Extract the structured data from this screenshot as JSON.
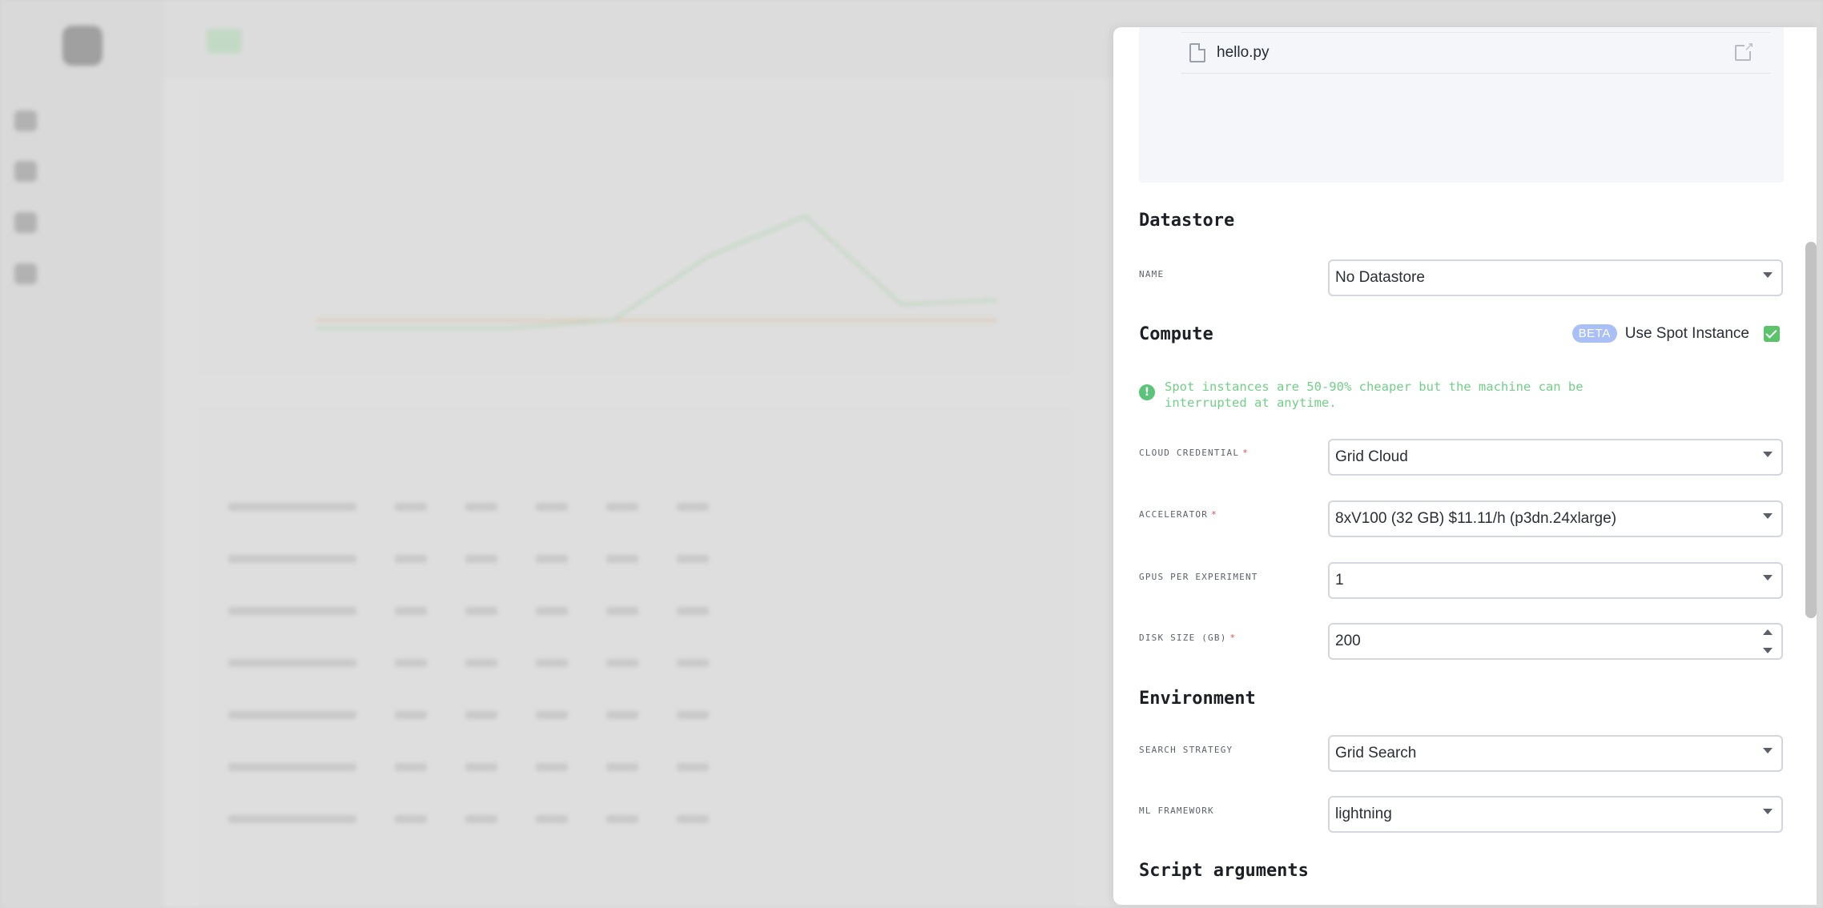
{
  "code_panel": {
    "file_name": "hello.py"
  },
  "datastore": {
    "title": "Datastore",
    "name_label": "NAME",
    "name_value": "No Datastore"
  },
  "compute": {
    "title": "Compute",
    "beta_badge": "BETA",
    "spot_label": "Use Spot Instance",
    "spot_checked": true,
    "spot_notice": "Spot instances are 50-90% cheaper but the machine can be interrupted at anytime.",
    "cloud_credential_label": "CLOUD CREDENTIAL",
    "cloud_credential_value": "Grid Cloud",
    "accelerator_label": "ACCELERATOR",
    "accelerator_value": "8xV100 (32 GB) $11.11/h (p3dn.24xlarge)",
    "gpus_label": "GPUS PER EXPERIMENT",
    "gpus_value": "1",
    "disk_label": "DISK SIZE (GB)",
    "disk_value": "200",
    "required_marker": "*"
  },
  "environment": {
    "title": "Environment",
    "search_strategy_label": "SEARCH STRATEGY",
    "search_strategy_value": "Grid Search",
    "ml_framework_label": "ML FRAMEWORK",
    "ml_framework_value": "lightning"
  },
  "script_arguments": {
    "title": "Script arguments"
  },
  "colors": {
    "accent_green": "#5bc46b",
    "beta_badge": "#a9bff6",
    "required_red": "#e04d5e"
  }
}
